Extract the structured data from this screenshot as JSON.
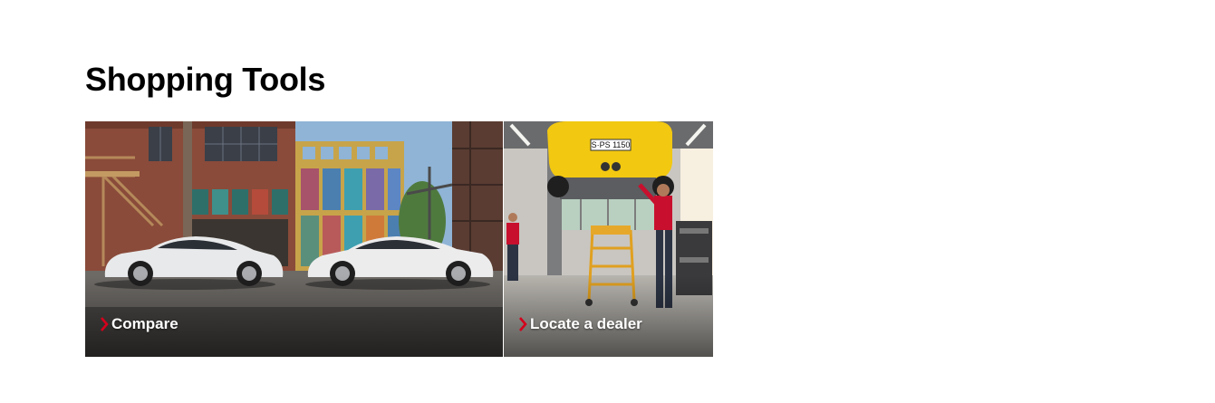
{
  "section": {
    "title": "Shopping Tools"
  },
  "tiles": [
    {
      "label": "Compare",
      "icon": "chevron-right-icon",
      "scene": "two-white-cars-in-front-of-brick-building"
    },
    {
      "label": "Locate a dealer",
      "icon": "chevron-right-icon",
      "scene": "mechanic-under-yellow-car-on-lift",
      "plate": "S·PS 1150"
    }
  ],
  "colors": {
    "accent": "#d5001c",
    "title": "#000000",
    "tile_text": "#ffffff"
  }
}
